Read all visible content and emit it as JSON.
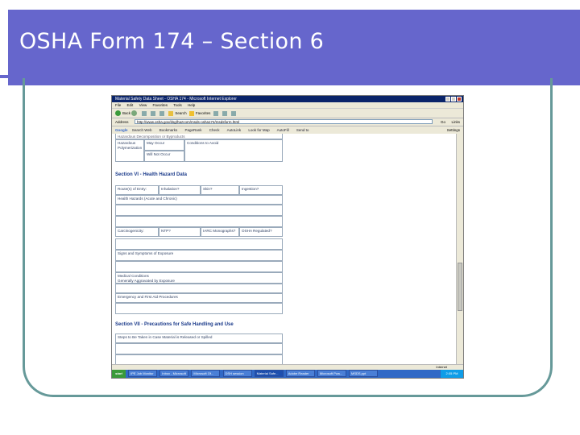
{
  "slide": {
    "title": "OSHA Form 174 – Section 6",
    "colors": {
      "title_bar": "#6666cc",
      "frame": "#669999"
    }
  },
  "browser": {
    "window_title": "Material Safety Data Sheet - OSHA 174 - Microsoft Internet Explorer",
    "menu": [
      "File",
      "Edit",
      "View",
      "Favorites",
      "Tools",
      "Help"
    ],
    "toolbar": {
      "back_label": "Back",
      "search_label": "Search",
      "favorites_label": "Favorites"
    },
    "address_label": "Address",
    "address": "http://www.osha.gov/dsg/hazcom/msds-osha174/msdsform.html",
    "go_label": "Go",
    "links_label": "Links",
    "google_toolbar": {
      "logo": "Google",
      "items": [
        "Search Web",
        "Bookmarks",
        "PageRank",
        "Check",
        "AutoLink",
        "Look for Map",
        "AutoFill",
        "Send to"
      ],
      "settings_label": "Settings"
    },
    "status_zone": "Internet",
    "taskbar": {
      "start": "start",
      "tasks": [
        "IPE Job Monitor",
        "Inbox - Microsoft",
        "Microsoft Of...",
        "DSH session",
        "Material Safe...",
        "Adobe Reader",
        "Microsoft Pow...",
        "MSDS.ppt"
      ],
      "clock": "2:05 PM"
    }
  },
  "form": {
    "top_partial": "Hazardous Decomposition or Byproducts",
    "polymerization": {
      "label": "Hazardous Polymerization",
      "may_occur": "May Occur",
      "will_not_occur": "Will Not Occur",
      "conditions": "Conditions to Avoid"
    },
    "section7": {
      "heading": "Section VI - Health Hazard Data",
      "routes": [
        "Route(s) of Entry:",
        "Inhalation?",
        "Skin?",
        "Ingestion?"
      ],
      "health_hazards": "Health Hazards (Acute and Chronic)",
      "carcinogenicity": [
        "Carcinogenicity:",
        "NTP?",
        "IARC Monographs?",
        "OSHA Regulated?"
      ],
      "signs": "Signs and Symptoms of Exposure",
      "medical": "Medical Conditions\nGenerally Aggravated by Exposure",
      "emergency": "Emergency and First Aid Procedures"
    },
    "section8": {
      "heading": "Section VII - Precautions for Safe Handling and Use",
      "steps": "Steps to Be Taken in Case Material is Released or Spilled"
    }
  }
}
